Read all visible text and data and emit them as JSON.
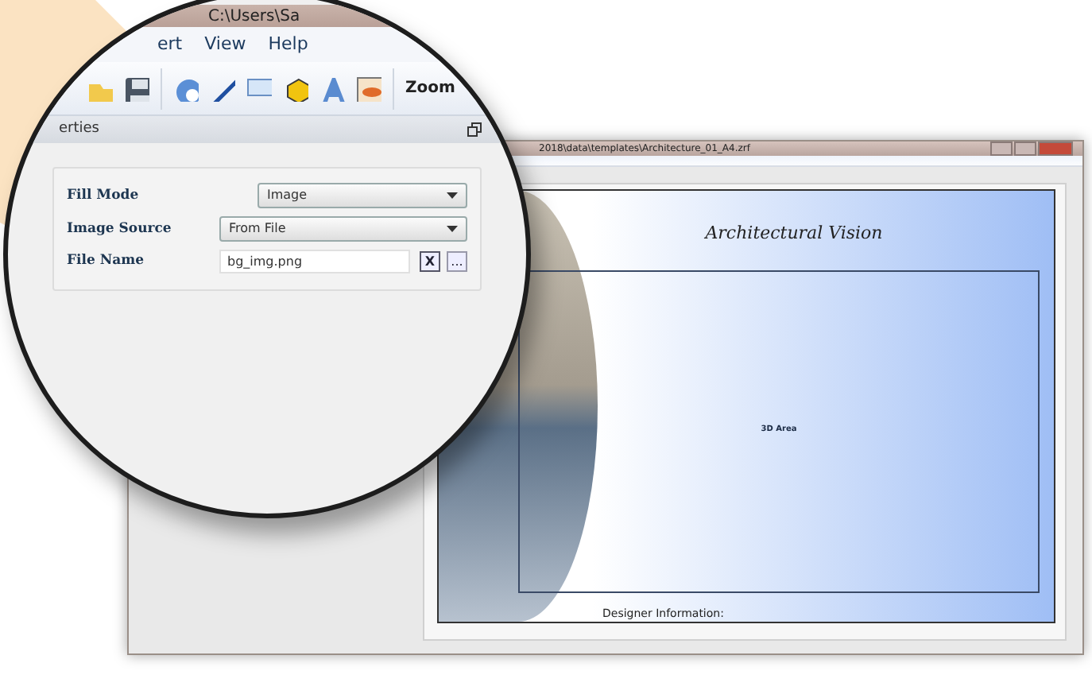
{
  "magnifier": {
    "title": "C:\\Users\\Sa",
    "menu": [
      "ert",
      "View",
      "Help"
    ],
    "toolbar": {
      "zoom_label": "Zoom"
    },
    "panel": {
      "title": "erties",
      "fields": [
        {
          "kind": "select",
          "label": "Fill Mode",
          "value": "Image"
        },
        {
          "kind": "select",
          "label": "Image Source",
          "value": "From File"
        },
        {
          "kind": "file",
          "label": "File Name",
          "value": "bg_img.png",
          "clear": "X",
          "browse": "..."
        }
      ]
    }
  },
  "window": {
    "title": "2018\\data\\templates\\Architecture_01_A4.zrf",
    "page": {
      "heading": "Architectural Vision",
      "area_label": "3D Area",
      "footer": "Designer Information:"
    }
  }
}
